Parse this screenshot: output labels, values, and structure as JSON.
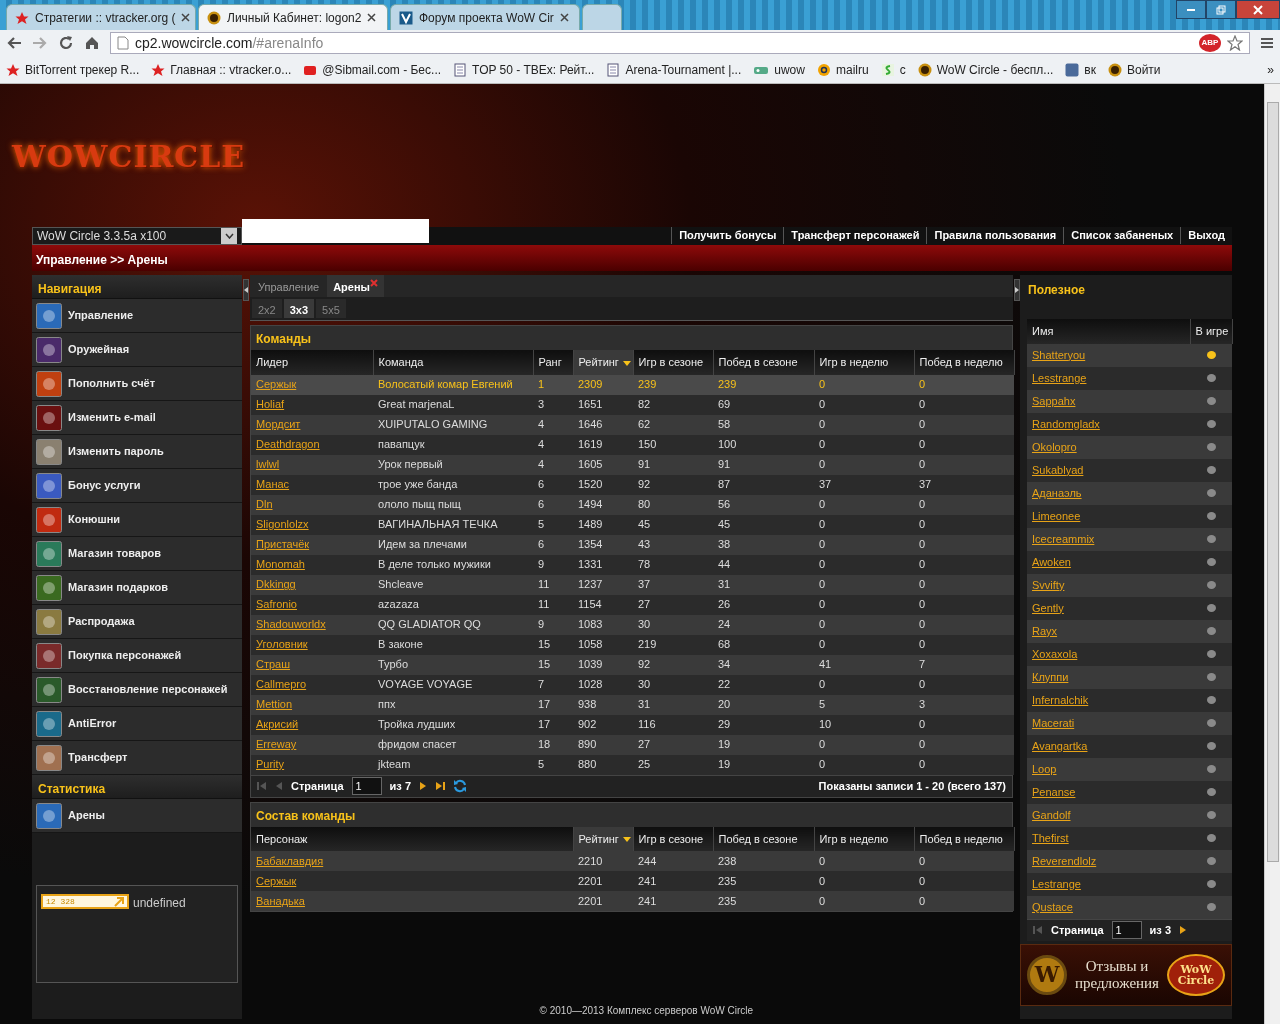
{
  "browser": {
    "tabs": [
      {
        "title": "Стратегии :: vtracker.org (",
        "selected": false,
        "kind": "star"
      },
      {
        "title": "Личный Кабинет: logon2",
        "selected": true,
        "kind": "wow"
      },
      {
        "title": "Форум проекта WoW Cir",
        "selected": false,
        "kind": "forum"
      }
    ],
    "address": {
      "host": "cp2.wowcircle.com",
      "path": "/#arenaInfo"
    },
    "adblock": "ABP",
    "bookmarks": [
      {
        "label": "BitTorrent трекер R...",
        "kind": "star"
      },
      {
        "label": "Главная :: vtracker.o...",
        "kind": "star"
      },
      {
        "label": "@Sibmail.com - Бес...",
        "kind": "mail"
      },
      {
        "label": "TOP 50 - TBEx: Рейт...",
        "kind": "doc"
      },
      {
        "label": "Arena-Tournament |...",
        "kind": "doc"
      },
      {
        "label": "uwow",
        "kind": "game"
      },
      {
        "label": "mailru",
        "kind": "at"
      },
      {
        "label": "c",
        "kind": "s"
      },
      {
        "label": "WoW Circle - беспл...",
        "kind": "wow"
      },
      {
        "label": "вк",
        "kind": "vk"
      },
      {
        "label": "Войти",
        "kind": "wow"
      }
    ],
    "more": "»"
  },
  "site": {
    "logo": "WOWCIRCLE",
    "realm_select": {
      "value": "WoW Circle 3.3.5a x100"
    },
    "top_links": [
      "Получить бонусы",
      "Трансферт персонажей",
      "Правила пользования",
      "Список забаненых",
      "Выход"
    ],
    "breadcrumb": "Управление >> Арены"
  },
  "nav": [
    {
      "title": "Навигация",
      "items": [
        "Управление",
        "Оружейная",
        "Пополнить счёт",
        "Изменить e-mail",
        "Изменить пароль",
        "Бонус услуги",
        "Конюшни",
        "Магазин товаров",
        "Магазин подарков",
        "Распродажа",
        "Покупка персонажей",
        "Восстановление персонажей",
        "AntiError",
        "Трансферт"
      ]
    },
    {
      "title": "Статистика",
      "items": [
        "Арены"
      ]
    }
  ],
  "counter": {
    "digits": "12 328",
    "text": "undefined"
  },
  "content": {
    "tabs": [
      {
        "label": "Управление",
        "selected": false,
        "closable": false
      },
      {
        "label": "Арены",
        "selected": true,
        "closable": true
      }
    ],
    "subtabs": [
      {
        "label": "2x2",
        "selected": false
      },
      {
        "label": "3x3",
        "selected": true
      },
      {
        "label": "5x5",
        "selected": false
      }
    ],
    "teams": {
      "title": "Команды",
      "columns": [
        {
          "label": "Лидер",
          "sorted": false
        },
        {
          "label": "Команда",
          "sorted": false
        },
        {
          "label": "Ранг",
          "sorted": false
        },
        {
          "label": "Рейтинг",
          "sorted": true
        },
        {
          "label": "Игр в сезоне",
          "sorted": false
        },
        {
          "label": "Побед в сезоне",
          "sorted": false
        },
        {
          "label": "Игр в неделю",
          "sorted": false
        },
        {
          "label": "Побед в неделю",
          "sorted": false
        }
      ],
      "rows": [
        {
          "selected": true,
          "cells": [
            "Сержык",
            "Волосатый комар Евгений",
            "1",
            "2309",
            "239",
            "239",
            "0",
            "0"
          ]
        },
        {
          "selected": false,
          "cells": [
            "Holiaf",
            "Great marjenaL",
            "3",
            "1651",
            "82",
            "69",
            "0",
            "0"
          ]
        },
        {
          "selected": false,
          "cells": [
            "Мордсит",
            "XUIPUTALO GAMING",
            "4",
            "1646",
            "62",
            "58",
            "0",
            "0"
          ]
        },
        {
          "selected": false,
          "cells": [
            "Deathdragon",
            "павапцук",
            "4",
            "1619",
            "150",
            "100",
            "0",
            "0"
          ]
        },
        {
          "selected": false,
          "cells": [
            "lwlwl",
            "Урок первый",
            "4",
            "1605",
            "91",
            "91",
            "0",
            "0"
          ]
        },
        {
          "selected": false,
          "cells": [
            "Манас",
            "трое уже банда",
            "6",
            "1520",
            "92",
            "87",
            "37",
            "37"
          ]
        },
        {
          "selected": false,
          "cells": [
            "Dln",
            "ололо пыщ пыщ",
            "6",
            "1494",
            "80",
            "56",
            "0",
            "0"
          ]
        },
        {
          "selected": false,
          "cells": [
            "Sligonlolzx",
            "ВАГИНАЛЬНАЯ ТЕЧКА",
            "5",
            "1489",
            "45",
            "45",
            "0",
            "0"
          ]
        },
        {
          "selected": false,
          "cells": [
            "Пристачёк",
            "Идем за плечами",
            "6",
            "1354",
            "43",
            "38",
            "0",
            "0"
          ]
        },
        {
          "selected": false,
          "cells": [
            "Monomah",
            "В деле только мужики",
            "9",
            "1331",
            "78",
            "44",
            "0",
            "0"
          ]
        },
        {
          "selected": false,
          "cells": [
            "Dkkingg",
            "Shcleave",
            "11",
            "1237",
            "37",
            "31",
            "0",
            "0"
          ]
        },
        {
          "selected": false,
          "cells": [
            "Safronio",
            "azazaza",
            "11",
            "1154",
            "27",
            "26",
            "0",
            "0"
          ]
        },
        {
          "selected": false,
          "cells": [
            "Shadouworldx",
            "QQ GLADIATOR QQ",
            "9",
            "1083",
            "30",
            "24",
            "0",
            "0"
          ]
        },
        {
          "selected": false,
          "cells": [
            "Уголовник",
            "В законе",
            "15",
            "1058",
            "219",
            "68",
            "0",
            "0"
          ]
        },
        {
          "selected": false,
          "cells": [
            "Страш",
            "Турбо",
            "15",
            "1039",
            "92",
            "34",
            "41",
            "7"
          ]
        },
        {
          "selected": false,
          "cells": [
            "Callmepro",
            "VOYAGE VOYAGE",
            "7",
            "1028",
            "30",
            "22",
            "0",
            "0"
          ]
        },
        {
          "selected": false,
          "cells": [
            "Mettion",
            "ппх",
            "17",
            "938",
            "31",
            "20",
            "5",
            "3"
          ]
        },
        {
          "selected": false,
          "cells": [
            "Акрисий",
            "Тройка лудших",
            "17",
            "902",
            "116",
            "29",
            "10",
            "0"
          ]
        },
        {
          "selected": false,
          "cells": [
            "Erreway",
            "фридом спасет",
            "18",
            "890",
            "27",
            "19",
            "0",
            "0"
          ]
        },
        {
          "selected": false,
          "cells": [
            "Purity",
            "jkteam",
            "5",
            "880",
            "25",
            "19",
            "0",
            "0"
          ]
        }
      ],
      "pager": {
        "page_label": "Страница",
        "page": "1",
        "of": "из 7",
        "summary": "Показаны записи 1 - 20 (всего 137)"
      }
    },
    "roster": {
      "title": "Состав команды",
      "columns": [
        {
          "label": "Персонаж",
          "sorted": false
        },
        {
          "label": "Рейтинг",
          "sorted": true
        },
        {
          "label": "Игр в сезоне",
          "sorted": false
        },
        {
          "label": "Побед в сезоне",
          "sorted": false
        },
        {
          "label": "Игр в неделю",
          "sorted": false
        },
        {
          "label": "Побед в неделю",
          "sorted": false
        }
      ],
      "rows": [
        {
          "selected": false,
          "cells": [
            "Бабаклавдия",
            "2210",
            "244",
            "238",
            "0",
            "0"
          ]
        },
        {
          "selected": false,
          "cells": [
            "Сержык",
            "2201",
            "241",
            "235",
            "0",
            "0"
          ]
        },
        {
          "selected": false,
          "cells": [
            "Ванадька",
            "2201",
            "241",
            "235",
            "0",
            "0"
          ]
        }
      ]
    },
    "footer": "© 2010—2013 Комплекс серверов WoW Circle"
  },
  "useful": {
    "title": "Полезное",
    "columns": [
      "Имя",
      "В игре"
    ],
    "rows": [
      {
        "name": "Shatteryou",
        "online": true
      },
      {
        "name": "Lesstrange",
        "online": false
      },
      {
        "name": "Sappahx",
        "online": false
      },
      {
        "name": "Randomgladx",
        "online": false
      },
      {
        "name": "Okolopro",
        "online": false
      },
      {
        "name": "Sukablyad",
        "online": false
      },
      {
        "name": "Аданаэль",
        "online": false
      },
      {
        "name": "Limeonee",
        "online": false
      },
      {
        "name": "Icecreammix",
        "online": false
      },
      {
        "name": "Awoken",
        "online": false
      },
      {
        "name": "Svvifty",
        "online": false
      },
      {
        "name": "Gently",
        "online": false
      },
      {
        "name": "Rayx",
        "online": false
      },
      {
        "name": "Xoxaxola",
        "online": false
      },
      {
        "name": "Клуппи",
        "online": false
      },
      {
        "name": "Infernalchik",
        "online": false
      },
      {
        "name": "Macerati",
        "online": false
      },
      {
        "name": "Avangartka",
        "online": false
      },
      {
        "name": "Loop",
        "online": false
      },
      {
        "name": "Penanse",
        "online": false
      },
      {
        "name": "Gandolf",
        "online": false
      },
      {
        "name": "Thefirst",
        "online": false
      },
      {
        "name": "Reverendlolz",
        "online": false
      },
      {
        "name": "Lestrange",
        "online": false
      },
      {
        "name": "Qustace",
        "online": false
      }
    ],
    "pager": {
      "page_label": "Страница",
      "page": "1",
      "of": "из 3"
    },
    "banner": {
      "lines": [
        "Отзывы и",
        "предложения"
      ],
      "badge": "W",
      "logo": "WoW Circle"
    }
  }
}
